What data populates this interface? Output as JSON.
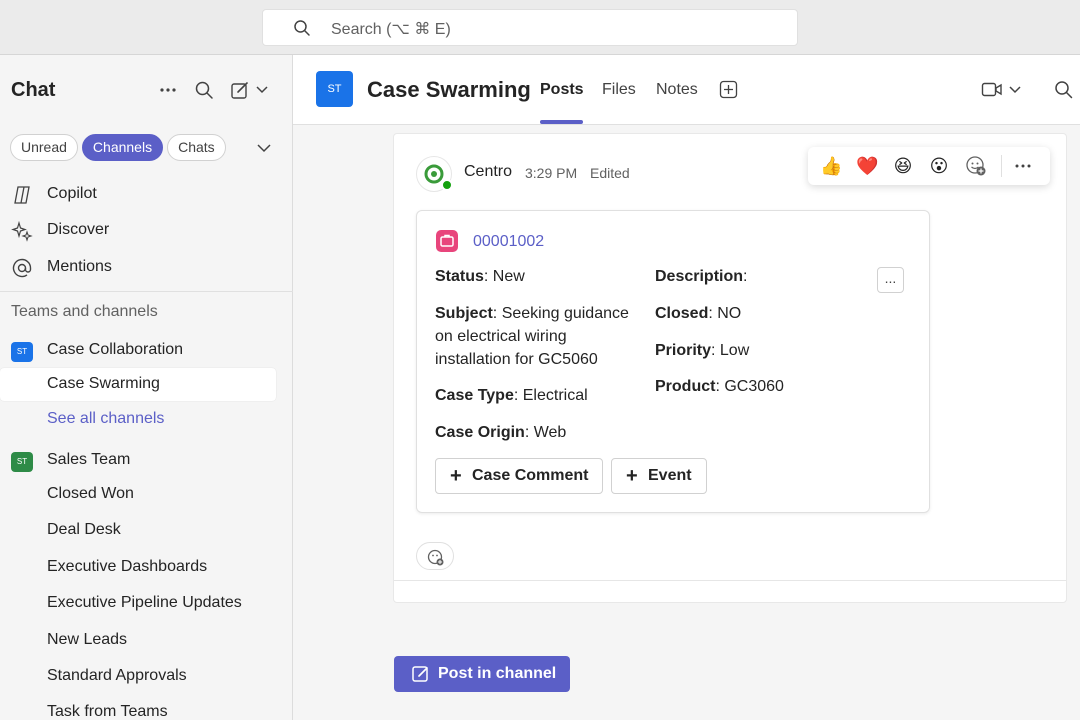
{
  "search": {
    "placeholder": "Search (⌥ ⌘ E)"
  },
  "sidebar": {
    "title": "Chat",
    "filters": [
      "Unread",
      "Channels",
      "Chats"
    ],
    "active_filter": "Channels",
    "top_items": [
      {
        "label": "Copilot",
        "icon": "copilot-icon"
      },
      {
        "label": "Discover",
        "icon": "sparkle-icon"
      },
      {
        "label": "Mentions",
        "icon": "at-icon"
      }
    ],
    "section_label": "Teams and channels",
    "teams": [
      {
        "name": "Case Collaboration",
        "initials": "ST",
        "color": "#1a73e8",
        "channels": [
          "Case Swarming"
        ],
        "see_all": "See all channels"
      },
      {
        "name": "Sales Team",
        "initials": "ST",
        "color": "#2e8b47",
        "channels": [
          "Closed Won",
          "Deal Desk",
          "Executive Dashboards",
          "Executive Pipeline Updates",
          "New Leads",
          "Standard Approvals",
          "Task from Teams"
        ]
      }
    ],
    "selected_channel": "Case Swarming"
  },
  "channel": {
    "initials": "ST",
    "title": "Case Swarming",
    "tabs": [
      "Posts",
      "Files",
      "Notes"
    ],
    "active_tab": "Posts"
  },
  "post": {
    "author": "Centro",
    "time": "3:29 PM",
    "edited": "Edited",
    "reactions": [
      "👍",
      "❤️",
      "😆",
      "😮"
    ],
    "card": {
      "case_number": "00001002",
      "more": "...",
      "fields": {
        "status_label": "Status",
        "status_value": "New",
        "subject_label": "Subject",
        "subject_value": "Seeking guidance on electrical wiring installation for GC5060",
        "case_type_label": "Case Type",
        "case_type_value": "Electrical",
        "case_origin_label": "Case Origin",
        "case_origin_value": "Web",
        "description_label": "Description",
        "description_value": "",
        "closed_label": "Closed",
        "closed_value": "NO",
        "priority_label": "Priority",
        "priority_value": "Low",
        "product_label": "Product",
        "product_value": "GC3060"
      },
      "buttons": [
        "Case Comment",
        "Event"
      ]
    }
  },
  "compose": {
    "post_label": "Post in channel"
  },
  "colors": {
    "accent": "#5b5fc7",
    "case_pink": "#e8457c",
    "presence": "#13a10e"
  }
}
